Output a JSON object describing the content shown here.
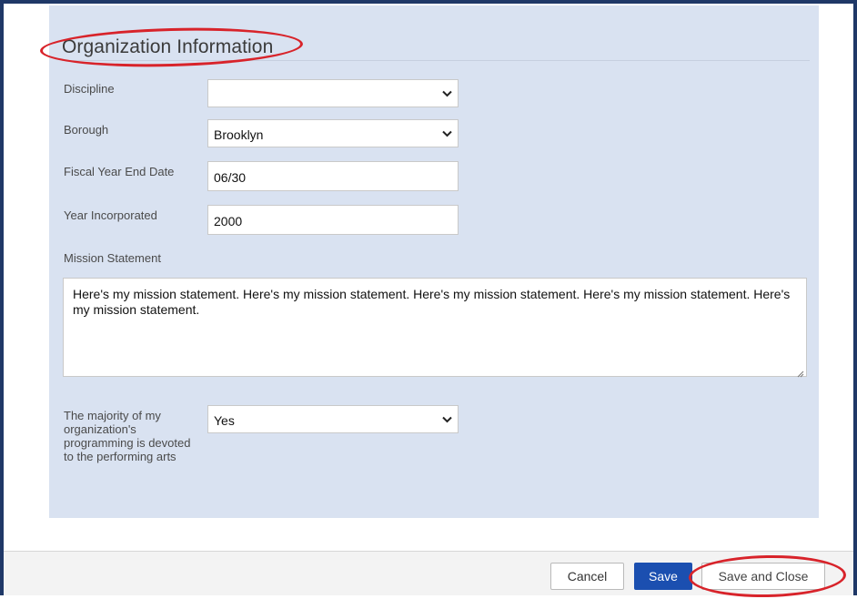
{
  "section": {
    "title": "Organization Information"
  },
  "fields": {
    "discipline": {
      "label": "Discipline",
      "value": ""
    },
    "borough": {
      "label": "Borough",
      "value": "Brooklyn"
    },
    "fiscal_year_end": {
      "label": "Fiscal Year End Date",
      "value": "06/30"
    },
    "year_incorporated": {
      "label": "Year Incorporated",
      "value": "2000"
    },
    "mission": {
      "label": "Mission Statement",
      "value": "Here's my mission statement. Here's my mission statement. Here's my mission statement. Here's my mission statement. Here's my mission statement."
    },
    "performing_arts": {
      "label": "The majority of my organization's programming is devoted to the performing arts",
      "value": "Yes"
    }
  },
  "footer": {
    "cancel_label": "Cancel",
    "save_label": "Save",
    "save_close_label": "Save and Close"
  },
  "colors": {
    "frame": "#1f3867",
    "panel": "#d9e2f1",
    "primary_button": "#1b4fb0",
    "highlight_oval": "#d8232a"
  },
  "icons": [
    "chevron-down-icon",
    "resize-grip-icon"
  ]
}
